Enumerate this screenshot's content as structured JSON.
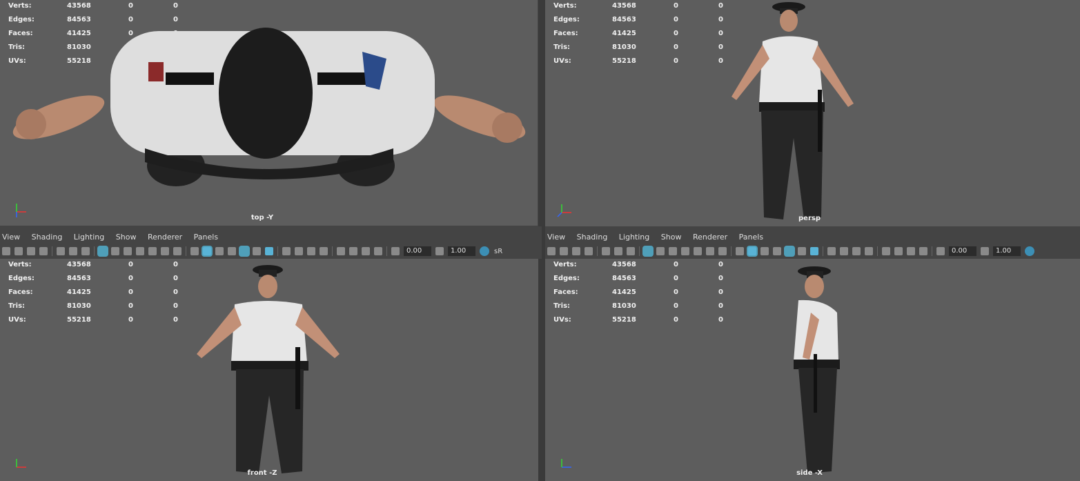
{
  "stats": [
    {
      "label": "Verts:",
      "values": [
        "43568",
        "0",
        "0"
      ]
    },
    {
      "label": "Edges:",
      "values": [
        "84563",
        "0",
        "0"
      ]
    },
    {
      "label": "Faces:",
      "values": [
        "41425",
        "0",
        "0"
      ]
    },
    {
      "label": "Tris:",
      "values": [
        "81030",
        "0",
        "0"
      ]
    },
    {
      "label": "UVs:",
      "values": [
        "55218",
        "0",
        "0"
      ]
    }
  ],
  "viewports": {
    "top": {
      "label": "top -Y"
    },
    "persp": {
      "label": "persp"
    },
    "front": {
      "label": "front -Z"
    },
    "side": {
      "label": "side -X"
    }
  },
  "panel_menu": [
    "View",
    "Shading",
    "Lighting",
    "Show",
    "Renderer",
    "Panels"
  ],
  "toolbar": {
    "field_1": "0.00",
    "field_2": "1.00",
    "trailing_text": "sR"
  },
  "axis": {
    "x": "x",
    "y": "y",
    "z": "z"
  },
  "colors": {
    "viewport_bg": "#5d5d5d",
    "panel_bg": "#444444",
    "accent": "#4f9fb9",
    "axis_x": "#e33",
    "axis_y": "#3d3",
    "axis_z": "#36f"
  }
}
